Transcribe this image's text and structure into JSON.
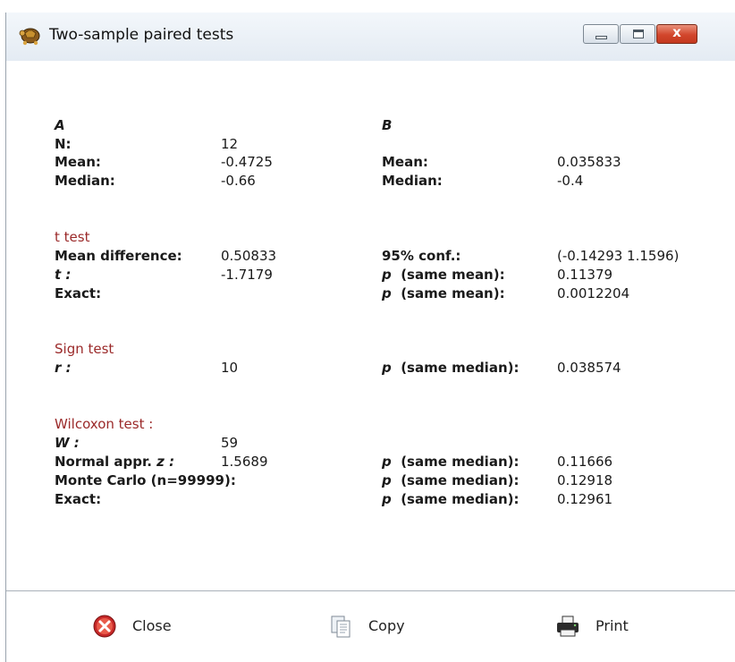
{
  "window": {
    "title": "Two-sample paired tests",
    "controls": {
      "minimize": "minimize",
      "maximize": "maximize",
      "close": "x"
    }
  },
  "sample_a": {
    "header": "A",
    "n_label": "N:",
    "n_value": "12",
    "mean_label": "Mean:",
    "mean_value": "-0.4725",
    "median_label": "Median:",
    "median_value": "-0.66"
  },
  "sample_b": {
    "header": "B",
    "mean_label": "Mean:",
    "mean_value": "0.035833",
    "median_label": "Median:",
    "median_value": "-0.4"
  },
  "t_test": {
    "title": "t test",
    "mean_diff_label": "Mean difference:",
    "mean_diff_value": "0.50833",
    "conf_label": "95% conf.:",
    "conf_value": "(-0.14293  1.1596)",
    "t_label": "t :",
    "t_value": "-1.7179",
    "p_label": "p",
    "p_same_mean_label": "(same mean):",
    "p_value": "0.11379",
    "exact_label": "Exact:",
    "exact_p_value": "0.0012204"
  },
  "sign_test": {
    "title": "Sign test",
    "r_label": "r :",
    "r_value": "10",
    "p_label": "p",
    "p_same_median_label": "(same median):",
    "p_value": "0.038574"
  },
  "wilcoxon_test": {
    "title": "Wilcoxon test  :",
    "w_label": "W :",
    "w_value": "59",
    "normal_label": "Normal appr.",
    "normal_z_label": "z :",
    "normal_z_value": "1.5689",
    "normal_p_value": "0.11666",
    "monte_carlo_label": "Monte Carlo (n=99999):",
    "monte_carlo_p_value": "0.12918",
    "exact_label": "Exact:",
    "exact_p_value": "0.12961",
    "p_label": "p",
    "p_same_median_label": "(same median):"
  },
  "footer": {
    "close_label": "Close",
    "copy_label": "Copy",
    "print_label": "Print"
  },
  "icons": {
    "app": "turtle-icon",
    "close": "close-x-circle-icon",
    "copy": "copy-documents-icon",
    "print": "printer-icon"
  },
  "colors": {
    "section_title": "#9b2a2a",
    "close_button": "#d2462c",
    "close_icon": "#c62828"
  }
}
